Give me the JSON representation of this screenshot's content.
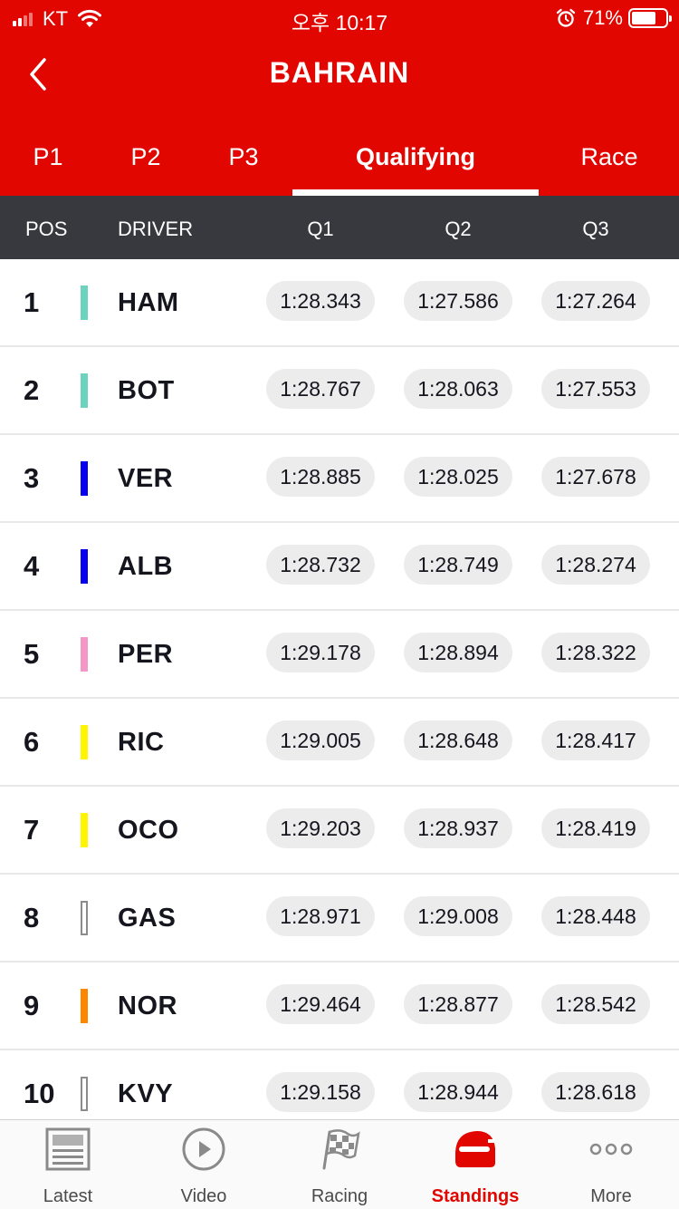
{
  "status_bar": {
    "carrier": "KT",
    "time": "오후 10:17",
    "battery_percent": "71%",
    "battery_level": 0.71
  },
  "header": {
    "title": "BAHRAIN",
    "back_icon": "chevron-left-icon"
  },
  "tabs": [
    {
      "label": "P1",
      "active": false
    },
    {
      "label": "P2",
      "active": false
    },
    {
      "label": "P3",
      "active": false
    },
    {
      "label": "Qualifying",
      "active": true
    },
    {
      "label": "Race",
      "active": false
    }
  ],
  "columns": {
    "pos": "POS",
    "driver": "DRIVER",
    "q1": "Q1",
    "q2": "Q2",
    "q3": "Q3"
  },
  "results": [
    {
      "pos": "1",
      "driver": "HAM",
      "team_color": "#6cd3bf",
      "outline": false,
      "q1": "1:28.343",
      "q2": "1:27.586",
      "q3": "1:27.264"
    },
    {
      "pos": "2",
      "driver": "BOT",
      "team_color": "#6cd3bf",
      "outline": false,
      "q1": "1:28.767",
      "q2": "1:28.063",
      "q3": "1:27.553"
    },
    {
      "pos": "3",
      "driver": "VER",
      "team_color": "#0600ef",
      "outline": false,
      "q1": "1:28.885",
      "q2": "1:28.025",
      "q3": "1:27.678"
    },
    {
      "pos": "4",
      "driver": "ALB",
      "team_color": "#0600ef",
      "outline": false,
      "q1": "1:28.732",
      "q2": "1:28.749",
      "q3": "1:28.274"
    },
    {
      "pos": "5",
      "driver": "PER",
      "team_color": "#f596c8",
      "outline": false,
      "q1": "1:29.178",
      "q2": "1:28.894",
      "q3": "1:28.322"
    },
    {
      "pos": "6",
      "driver": "RIC",
      "team_color": "#fff500",
      "outline": false,
      "q1": "1:29.005",
      "q2": "1:28.648",
      "q3": "1:28.417"
    },
    {
      "pos": "7",
      "driver": "OCO",
      "team_color": "#fff500",
      "outline": false,
      "q1": "1:29.203",
      "q2": "1:28.937",
      "q3": "1:28.419"
    },
    {
      "pos": "8",
      "driver": "GAS",
      "team_color": "#ffffff",
      "outline": true,
      "q1": "1:28.971",
      "q2": "1:29.008",
      "q3": "1:28.448"
    },
    {
      "pos": "9",
      "driver": "NOR",
      "team_color": "#ff8700",
      "outline": false,
      "q1": "1:29.464",
      "q2": "1:28.877",
      "q3": "1:28.542"
    },
    {
      "pos": "10",
      "driver": "KVY",
      "team_color": "#ffffff",
      "outline": true,
      "q1": "1:29.158",
      "q2": "1:28.944",
      "q3": "1:28.618"
    }
  ],
  "bottom_nav": [
    {
      "label": "Latest",
      "icon": "newspaper-icon",
      "active": false
    },
    {
      "label": "Video",
      "icon": "play-icon",
      "active": false
    },
    {
      "label": "Racing",
      "icon": "checkered-flag-icon",
      "active": false
    },
    {
      "label": "Standings",
      "icon": "helmet-icon",
      "active": true
    },
    {
      "label": "More",
      "icon": "more-dots-icon",
      "active": false
    }
  ],
  "colors": {
    "brand_red": "#e10600",
    "header_dark": "#38383f",
    "time_pill": "#ececec"
  }
}
